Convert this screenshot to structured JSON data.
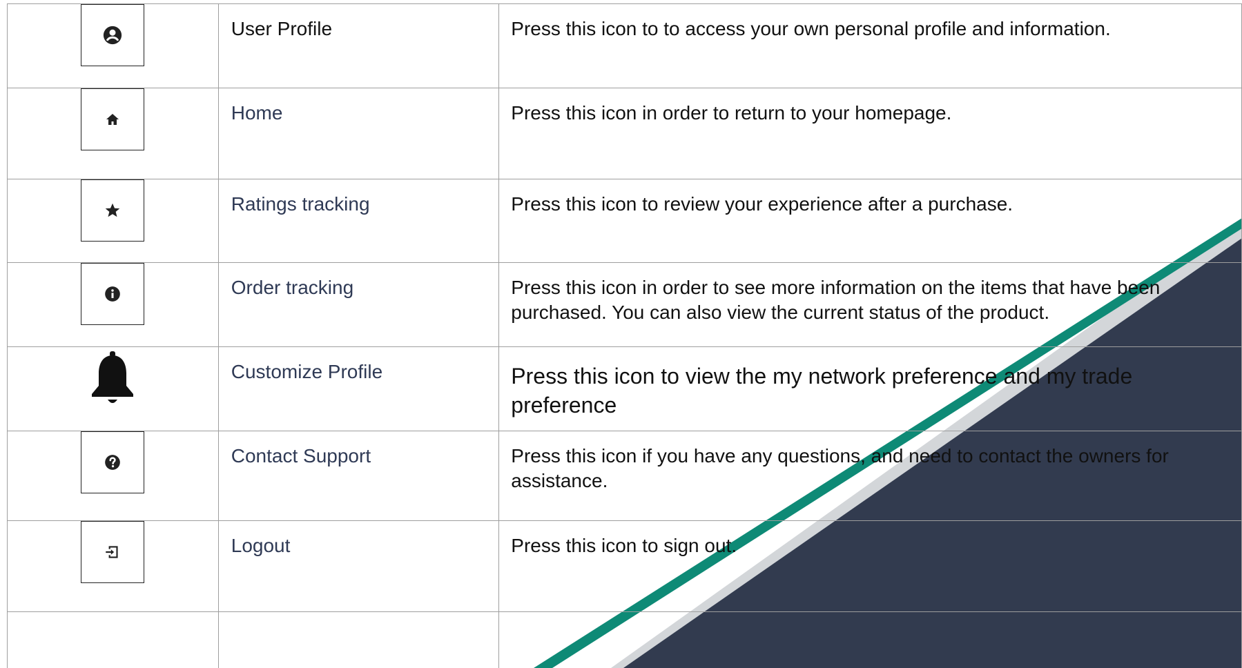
{
  "rows": [
    {
      "icon": "account-circle-icon",
      "name": "User Profile",
      "description": "Press this icon to to access your own personal profile and information."
    },
    {
      "icon": "home-icon",
      "name": "Home",
      "description": "Press this icon in order to return to your homepage."
    },
    {
      "icon": "star-icon",
      "name": "Ratings tracking",
      "description": "Press this icon to review your experience after a purchase."
    },
    {
      "icon": "info-icon",
      "name": "Order tracking",
      "description": "Press this icon in order to see more information on the items that have been purchased. You can also view the current status of the product."
    },
    {
      "icon": "bell-icon",
      "name": "Customize Profile",
      "description": "Press this icon to view the my network preference and my trade preference"
    },
    {
      "icon": "help-icon",
      "name": "Contact Support",
      "description": "Press this icon if you have any questions, and need to contact the owners for assistance."
    },
    {
      "icon": "logout-icon",
      "name": "Logout",
      "description": "Press this icon to sign out."
    }
  ],
  "colors": {
    "decor_navy": "#323b4f",
    "decor_teal": "#0e8a76",
    "decor_gray": "#d3d6d9",
    "link_text": "#2f3a55",
    "border": "#9e9e9e"
  }
}
